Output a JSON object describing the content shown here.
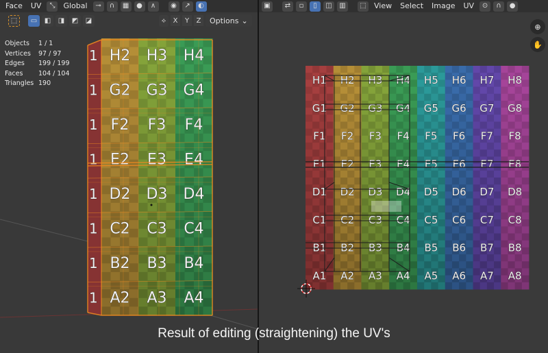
{
  "header_left": {
    "menu_face": "Face",
    "menu_uv": "UV",
    "transform_orientation": "Global",
    "pivot_icon": "pivot-icon",
    "snap_icon": "magnet-icon",
    "proportional_icon": "proportional-edit-icon"
  },
  "viewport_toolbar": {
    "axis_x": "X",
    "axis_y": "Y",
    "axis_z": "Z",
    "options_label": "Options"
  },
  "stats": {
    "objects_label": "Objects",
    "objects_value": "1 / 1",
    "vertices_label": "Vertices",
    "vertices_value": "97 / 97",
    "edges_label": "Edges",
    "edges_value": "199 / 199",
    "faces_label": "Faces",
    "faces_value": "104 / 104",
    "triangles_label": "Triangles",
    "triangles_value": "190"
  },
  "header_right": {
    "menu_view": "View",
    "menu_select": "Select",
    "menu_image": "Image",
    "menu_uv": "UV"
  },
  "uv_grid": {
    "rows": [
      "H",
      "G",
      "F",
      "E",
      "D",
      "C",
      "B",
      "A"
    ],
    "cols": [
      "1",
      "2",
      "3",
      "4",
      "5",
      "6",
      "7",
      "8"
    ]
  },
  "mesh_labels": [
    {
      "text": "H2"
    },
    {
      "text": "H3"
    },
    {
      "text": "H4"
    },
    {
      "text": "G2"
    },
    {
      "text": "G3"
    },
    {
      "text": "G4"
    },
    {
      "text": "F2"
    },
    {
      "text": "F3"
    },
    {
      "text": "F4"
    },
    {
      "text": "E2"
    },
    {
      "text": "E3"
    },
    {
      "text": "E4"
    },
    {
      "text": "D2"
    },
    {
      "text": "D3"
    },
    {
      "text": "D4"
    },
    {
      "text": "C2"
    },
    {
      "text": "C3"
    },
    {
      "text": "C4"
    },
    {
      "text": "B2"
    },
    {
      "text": "B3"
    },
    {
      "text": "B4"
    },
    {
      "text": "A2"
    },
    {
      "text": "A3"
    },
    {
      "text": "A4"
    }
  ],
  "colors": {
    "col_hues": [
      "#b34444",
      "#c49a3c",
      "#8fb13f",
      "#3fa85c",
      "#2fa6a6",
      "#3e74b8",
      "#6a4db8",
      "#b34aa6"
    ],
    "selection_orange": "#f28a1f"
  },
  "caption": "Result of editing (straightening) the UV's"
}
